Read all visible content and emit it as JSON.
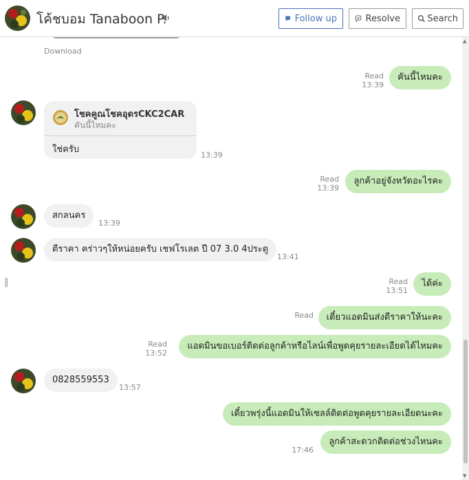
{
  "header": {
    "title": "โค้ชบอม Tanaboon P.",
    "follow_up_label": "Follow up",
    "resolve_label": "Resolve",
    "search_label": "Search",
    "accent_color": "#4a73b8"
  },
  "previous": {
    "download_label": "Download"
  },
  "messages": [
    {
      "direction": "out",
      "text": "คันนี้ไหมคะ",
      "status": "Read",
      "time": "13:39"
    },
    {
      "direction": "in",
      "reply_to_name": "โชคคูณโชคอุดรCKC2CAR",
      "reply_to_text": "คันนี้ไหมคะ",
      "text": "ใช่ครับ",
      "time": "13:39"
    },
    {
      "direction": "out",
      "text": "ลูกค้าอยู่จังหวัดอะไรคะ",
      "status": "Read",
      "time": "13:39"
    },
    {
      "direction": "in",
      "text": "สกลนคร",
      "time": "13:39"
    },
    {
      "direction": "in",
      "text": "ตีราคา คร่าวๆให้หน่อยครับ เชฟโรเลต ปี 07 3.0 4ประตู",
      "time": "13:41"
    },
    {
      "direction": "out",
      "text": "ได้ค่ะ",
      "status": "Read",
      "time": "13:51"
    },
    {
      "direction": "out",
      "text": "เดี๋ยวแอดมินส่งตีราคาให้นะคะ",
      "status": "Read",
      "time": ""
    },
    {
      "direction": "out",
      "text": "แอดมินขอเบอร์ติดต่อลูกค้าหรือไลน์เพื่อพูดคุยรายละเอียดได้ไหมคะ",
      "status": "Read",
      "time": "13:52"
    },
    {
      "direction": "in",
      "text": "0828559553",
      "time": "13:57"
    },
    {
      "direction": "out",
      "text": "เดี๋ยวพรุ่งนี้แอดมินให้เซลล์ติดต่อพูดคุยรายละเอียดนะคะ",
      "status": "",
      "time": ""
    },
    {
      "direction": "out",
      "text": "ลูกค้าสะดวกติดต่อช่วงไหนคะ",
      "status": "",
      "time": "17:46"
    }
  ],
  "colors": {
    "outgoing_bubble": "#c7ecb9",
    "incoming_bubble": "#f1f1f1"
  }
}
